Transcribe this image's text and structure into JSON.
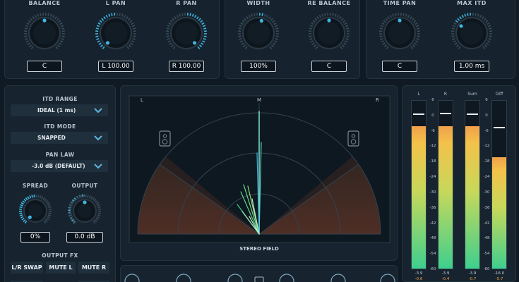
{
  "top_knobs": [
    {
      "label": "BALANCE",
      "value": "C",
      "level": 0.5
    },
    {
      "label": "L PAN",
      "value": "L 100.00",
      "level": 0.0
    },
    {
      "label": "R PAN",
      "value": "R 100.00",
      "level": 1.0
    },
    {
      "label": "WIDTH",
      "value": "100%",
      "level": 0.55
    },
    {
      "label": "RE BALANCE",
      "value": "C",
      "level": 0.5
    },
    {
      "label": "TIME PAN",
      "value": "C",
      "level": 0.5
    },
    {
      "label": "MAX ITD",
      "value": "1.00 ms",
      "level": 0.3
    }
  ],
  "left": {
    "itd_range_label": "ITD RANGE",
    "itd_range_value": "IDEAL (1 ms)",
    "itd_mode_label": "ITD MODE",
    "itd_mode_value": "SNAPPED",
    "pan_law_label": "PAN LAW",
    "pan_law_value": "-3.0 dB (DEFAULT)",
    "spread_label": "SPREAD",
    "spread_value": "0%",
    "spread_level": 0.0,
    "output_label": "OUTPUT",
    "output_value": "0.0 dB",
    "output_level": 0.5,
    "fx_label": "OUTPUT FX",
    "fx_buttons": [
      "L/R SWAP",
      "MUTE L",
      "MUTE R"
    ]
  },
  "field": {
    "left_label": "L",
    "mid_label": "M",
    "right_label": "R",
    "title": "STEREO FIELD"
  },
  "meters": {
    "labels": [
      "L",
      "R",
      "Sum",
      "Diff"
    ],
    "scale": [
      "6",
      "0",
      "-6",
      "-12",
      "-18",
      "-24",
      "-30",
      "-36",
      "-42",
      "-48",
      "-54",
      "-60"
    ],
    "bars": [
      {
        "name": "L",
        "level_db": -3.9,
        "peak_db": -0.6
      },
      {
        "name": "R",
        "level_db": -3.9,
        "peak_db": -0.4
      },
      {
        "name": "Sum",
        "level_db": -3.9,
        "peak_db": -0.7
      },
      {
        "name": "Diff",
        "level_db": -16.0,
        "peak_db": -5.7
      }
    ],
    "readouts_top": [
      "-3.9",
      "-3.9",
      "-3.9",
      "-16.0"
    ],
    "readouts_bottom": [
      "-0.6",
      "-0.4",
      "-0.7",
      "-5.7"
    ]
  },
  "colors": {
    "accent": "#3fb6e0",
    "knob_body": "#0e161d",
    "meter_green": "#3fcf8e",
    "meter_yellow": "#f3c24a",
    "meter_orange": "#f0a04a",
    "field_line": "#5fd3c4"
  }
}
